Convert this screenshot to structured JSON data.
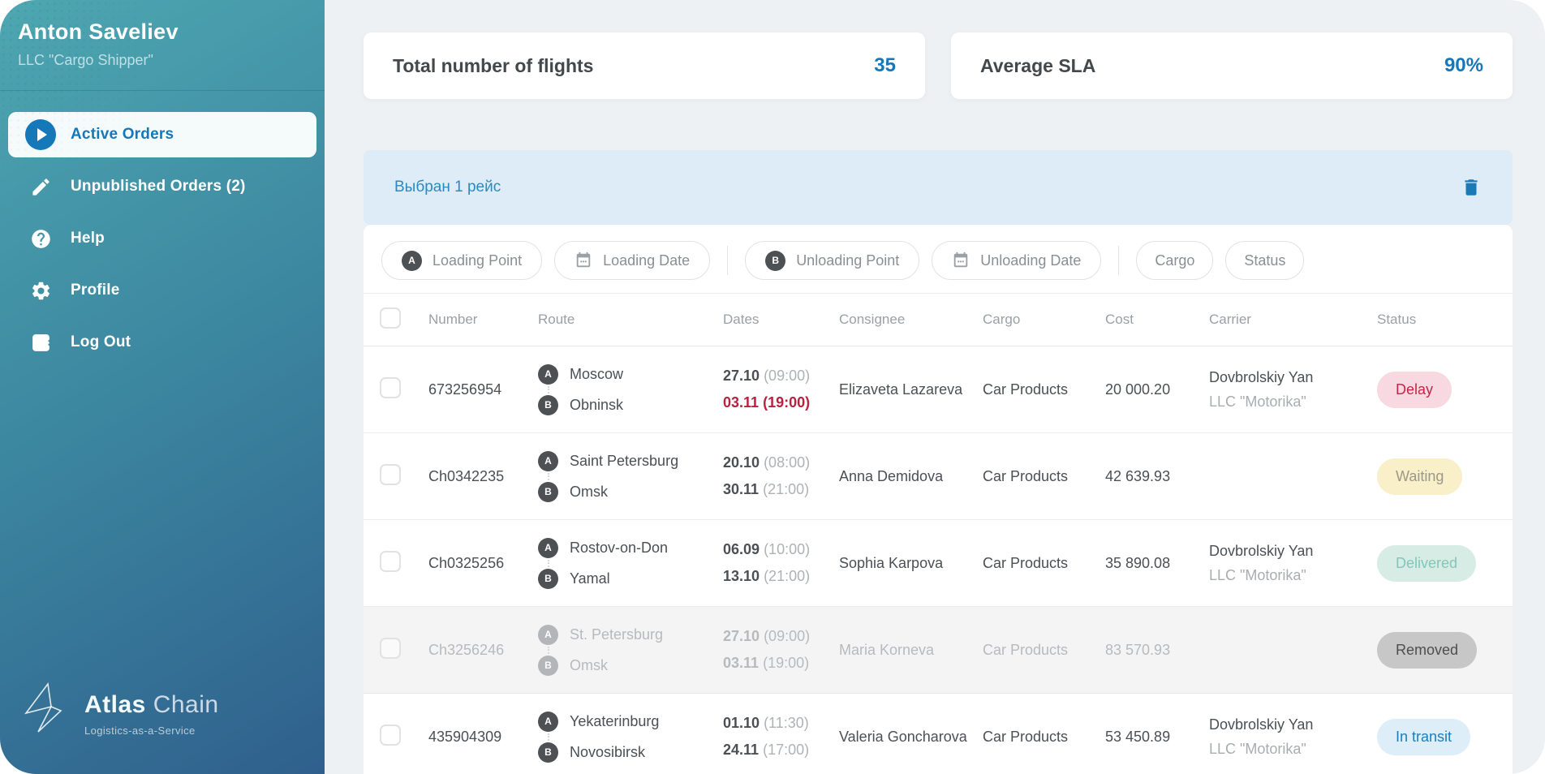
{
  "sidebar": {
    "user_name": "Anton Saveliev",
    "user_company": "LLC \"Cargo Shipper\"",
    "nav": [
      {
        "label": "Active Orders"
      },
      {
        "label": "Unpublished Orders (2)"
      },
      {
        "label": "Help"
      },
      {
        "label": "Profile"
      },
      {
        "label": "Log Out"
      }
    ],
    "logo_primary": "Atlas",
    "logo_secondary": "Chain",
    "logo_tagline": "Logistics-as-a-Service"
  },
  "stats": [
    {
      "label": "Total number of flights",
      "value": "35"
    },
    {
      "label": "Average SLA",
      "value": "90%"
    }
  ],
  "selection": {
    "text": "Выбран 1 рейс"
  },
  "filters": {
    "loading_point": "Loading Point",
    "loading_date": "Loading Date",
    "unloading_point": "Unloading Point",
    "unloading_date": "Unloading Date",
    "cargo": "Cargo",
    "status": "Status"
  },
  "badges": {
    "a": "A",
    "b": "B"
  },
  "table": {
    "columns": {
      "number": "Number",
      "route": "Route",
      "dates": "Dates",
      "consignee": "Consignee",
      "cargo": "Cargo",
      "cost": "Cost",
      "carrier": "Carrier",
      "status": "Status"
    },
    "rows": [
      {
        "number": "673256954",
        "from": "Moscow",
        "to": "Obninsk",
        "load_date": "27.10",
        "load_time": "(09:00)",
        "unload_date": "03.11",
        "unload_time": "(19:00)",
        "consignee": "Elizaveta Lazareva",
        "cargo": "Car Products",
        "cost": "20 000.20",
        "carrier_name": "Dovbrolskiy Yan",
        "carrier_company": "LLC \"Motorika\"",
        "status": "Delay"
      },
      {
        "number": "Ch0342235",
        "from": "Saint Petersburg",
        "to": "Omsk",
        "load_date": "20.10",
        "load_time": "(08:00)",
        "unload_date": "30.11",
        "unload_time": "(21:00)",
        "consignee": "Anna Demidova",
        "cargo": "Car Products",
        "cost": "42 639.93",
        "carrier_name": "",
        "carrier_company": "",
        "status": "Waiting"
      },
      {
        "number": "Ch0325256",
        "from": "Rostov-on-Don",
        "to": "Yamal",
        "load_date": "06.09",
        "load_time": "(10:00)",
        "unload_date": "13.10",
        "unload_time": "(21:00)",
        "consignee": "Sophia Karpova",
        "cargo": "Car Products",
        "cost": "35 890.08",
        "carrier_name": "Dovbrolskiy Yan",
        "carrier_company": "LLC \"Motorika\"",
        "status": "Delivered"
      },
      {
        "number": "Ch3256246",
        "from": "St. Petersburg",
        "to": "Omsk",
        "load_date": "27.10",
        "load_time": "(09:00)",
        "unload_date": "03.11",
        "unload_time": "(19:00)",
        "consignee": "Maria Korneva",
        "cargo": "Car Products",
        "cost": "83 570.93",
        "carrier_name": "",
        "carrier_company": "",
        "status": "Removed"
      },
      {
        "number": "435904309",
        "from": "Yekaterinburg",
        "to": "Novosibirsk",
        "load_date": "01.10",
        "load_time": "(11:30)",
        "unload_date": "24.11",
        "unload_time": "(17:00)",
        "consignee": "Valeria Goncharova",
        "cargo": "Car Products",
        "cost": "53 450.89",
        "carrier_name": "Dovbrolskiy Yan",
        "carrier_company": "LLC \"Motorika\"",
        "status": "In transit"
      }
    ]
  },
  "colors": {
    "accent_blue": "#1478b9",
    "sidebar_top": "#4ea7b1",
    "sidebar_bottom": "#2f608d",
    "page_bg": "#edf1f3",
    "selection_bg": "#ddecf6",
    "alert_red": "#b8213f",
    "delay_bg": "#f8d9e1",
    "waiting_bg": "#f9efc8",
    "delivered_bg": "#d8ece6",
    "removed_bg": "#c7c7c7",
    "transit_bg": "#ddeef9"
  }
}
